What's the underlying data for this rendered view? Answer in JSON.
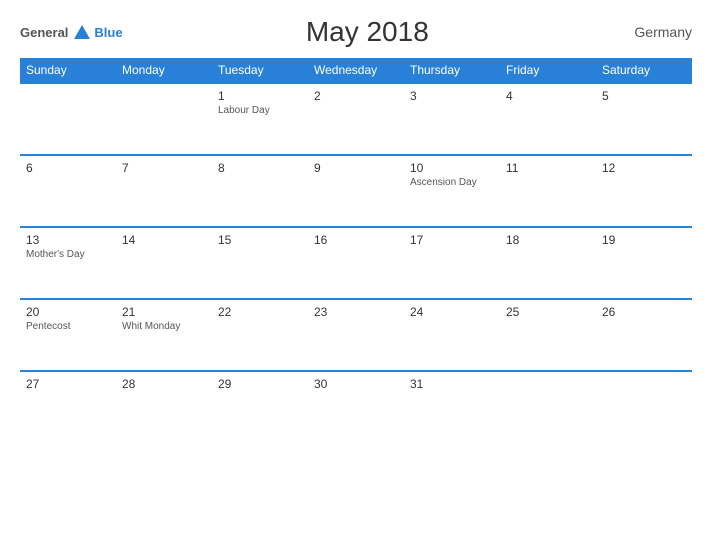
{
  "header": {
    "logo_general": "General",
    "logo_blue": "Blue",
    "title": "May 2018",
    "country": "Germany"
  },
  "weekdays": [
    "Sunday",
    "Monday",
    "Tuesday",
    "Wednesday",
    "Thursday",
    "Friday",
    "Saturday"
  ],
  "weeks": [
    [
      {
        "day": "",
        "holiday": ""
      },
      {
        "day": "",
        "holiday": ""
      },
      {
        "day": "1",
        "holiday": "Labour Day"
      },
      {
        "day": "2",
        "holiday": ""
      },
      {
        "day": "3",
        "holiday": ""
      },
      {
        "day": "4",
        "holiday": ""
      },
      {
        "day": "5",
        "holiday": ""
      }
    ],
    [
      {
        "day": "6",
        "holiday": ""
      },
      {
        "day": "7",
        "holiday": ""
      },
      {
        "day": "8",
        "holiday": ""
      },
      {
        "day": "9",
        "holiday": ""
      },
      {
        "day": "10",
        "holiday": "Ascension Day"
      },
      {
        "day": "11",
        "holiday": ""
      },
      {
        "day": "12",
        "holiday": ""
      }
    ],
    [
      {
        "day": "13",
        "holiday": "Mother's Day"
      },
      {
        "day": "14",
        "holiday": ""
      },
      {
        "day": "15",
        "holiday": ""
      },
      {
        "day": "16",
        "holiday": ""
      },
      {
        "day": "17",
        "holiday": ""
      },
      {
        "day": "18",
        "holiday": ""
      },
      {
        "day": "19",
        "holiday": ""
      }
    ],
    [
      {
        "day": "20",
        "holiday": "Pentecost"
      },
      {
        "day": "21",
        "holiday": "Whit Monday"
      },
      {
        "day": "22",
        "holiday": ""
      },
      {
        "day": "23",
        "holiday": ""
      },
      {
        "day": "24",
        "holiday": ""
      },
      {
        "day": "25",
        "holiday": ""
      },
      {
        "day": "26",
        "holiday": ""
      }
    ],
    [
      {
        "day": "27",
        "holiday": ""
      },
      {
        "day": "28",
        "holiday": ""
      },
      {
        "day": "29",
        "holiday": ""
      },
      {
        "day": "30",
        "holiday": ""
      },
      {
        "day": "31",
        "holiday": ""
      },
      {
        "day": "",
        "holiday": ""
      },
      {
        "day": "",
        "holiday": ""
      }
    ]
  ]
}
